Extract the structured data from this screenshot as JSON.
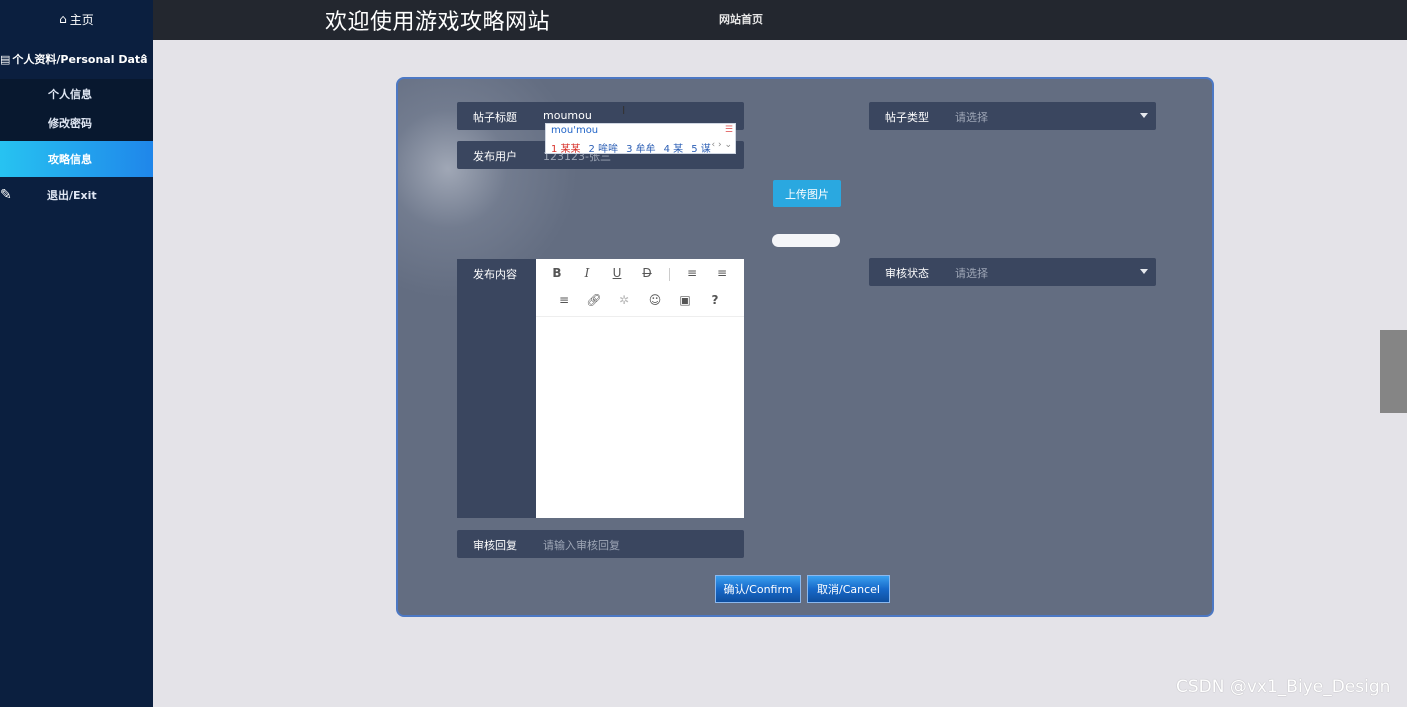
{
  "sidebar": {
    "home_icon": "home-icon",
    "home_label": "主页",
    "group_label": "个人资料/Personal Data",
    "group_icon": "list-icon",
    "items": [
      {
        "label": "个人信息"
      },
      {
        "label": "修改密码"
      },
      {
        "label": "攻略信息"
      }
    ],
    "exit_label": "退出/Exit",
    "exit_icon": "ruler-icon",
    "active_color_start": "#27c3f1",
    "active_color_end": "#1f86ea"
  },
  "header": {
    "title": "欢迎使用游戏攻略网站",
    "nav_home": "网站首页"
  },
  "form": {
    "post_title": {
      "label": "帖子标题",
      "value": "moumou"
    },
    "post_type": {
      "label": "帖子类型",
      "placeholder": "请选择"
    },
    "publisher": {
      "label": "发布用户",
      "value": "123123-张三"
    },
    "upload_button": "上传图片",
    "content": {
      "label": "发布内容"
    },
    "review_status": {
      "label": "审核状态",
      "placeholder": "请选择"
    },
    "review_reply": {
      "label": "审核回复",
      "placeholder": "请输入审核回复"
    },
    "confirm_button": "确认/Confirm",
    "cancel_button": "取消/Cancel"
  },
  "ime": {
    "pinyin": "mou'mou",
    "candidates": [
      "1 某某",
      "2 哞哞",
      "3 牟牟",
      "4 某",
      "5 谋"
    ],
    "more": "‹ › ⌄"
  },
  "editor_toolbar": [
    "B",
    "I",
    "U",
    "D",
    "align-left",
    "align-center",
    "align-right",
    "link",
    "unlink",
    "emoji",
    "image",
    "?"
  ],
  "watermark": "CSDN @vx1_Biye_Design"
}
